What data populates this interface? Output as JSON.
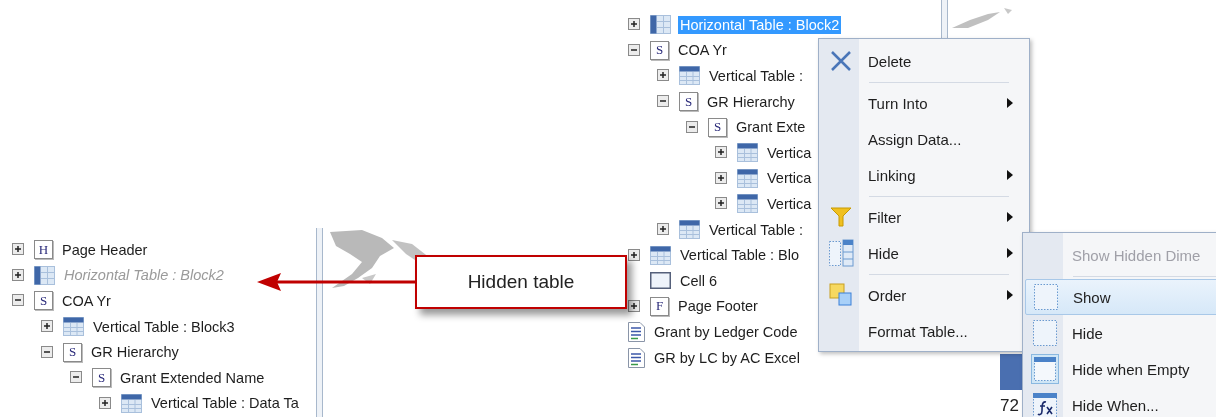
{
  "left_tree": [
    {
      "expanded": false,
      "kind": "letter",
      "glyph": "H",
      "label": "Page Header",
      "hidden": false
    },
    {
      "expanded": false,
      "kind": "htable",
      "label": "Horizontal Table : Block2",
      "hidden": true
    },
    {
      "expanded": true,
      "kind": "letter",
      "glyph": "S",
      "label": "COA Yr",
      "hidden": false,
      "children": [
        {
          "expanded": false,
          "kind": "vtable",
          "label": "Vertical Table : Block3",
          "hidden": false
        },
        {
          "expanded": true,
          "kind": "letter",
          "glyph": "S",
          "label": "GR Hierarchy",
          "hidden": false,
          "children": [
            {
              "expanded": true,
              "kind": "letter",
              "glyph": "S",
              "label": "Grant Extended Name",
              "hidden": false,
              "children": [
                {
                  "expanded": false,
                  "kind": "vtable",
                  "label": "Vertical Table : Data Ta",
                  "hidden": false
                }
              ]
            }
          ]
        }
      ]
    }
  ],
  "callout": {
    "text": "Hidden table"
  },
  "right_tree": [
    {
      "expanded": false,
      "kind": "htable",
      "label": "Horizontal Table : Block2",
      "selected": true
    },
    {
      "expanded": true,
      "kind": "letter",
      "glyph": "S",
      "label": "COA Yr",
      "selected": false,
      "children": [
        {
          "expanded": false,
          "kind": "vtable",
          "label": "Vertical Table :",
          "selected": false
        },
        {
          "expanded": true,
          "kind": "letter",
          "glyph": "S",
          "label": "GR Hierarchy",
          "selected": false,
          "children": [
            {
              "expanded": true,
              "kind": "letter",
              "glyph": "S",
              "label": "Grant Exte",
              "selected": false,
              "children": [
                {
                  "expanded": false,
                  "kind": "vtable",
                  "label": "Vertica",
                  "selected": false
                },
                {
                  "expanded": false,
                  "kind": "vtable",
                  "label": "Vertica",
                  "selected": false
                },
                {
                  "expanded": false,
                  "kind": "vtable",
                  "label": "Vertica",
                  "selected": false
                }
              ]
            }
          ]
        },
        {
          "expanded": false,
          "kind": "vtable",
          "label": "Vertical Table :",
          "selected": false
        }
      ]
    },
    {
      "expanded": false,
      "kind": "vtable",
      "label": "Vertical Table : Blo",
      "selected": false
    },
    {
      "kind": "cell",
      "label": "Cell 6",
      "selected": false
    },
    {
      "expanded": false,
      "kind": "letter",
      "glyph": "F",
      "label": "Page Footer",
      "selected": false
    },
    {
      "kind": "report",
      "label": "Grant by Ledger Code",
      "selected": false
    },
    {
      "kind": "report",
      "label": "GR by LC by AC Excel",
      "selected": false
    }
  ],
  "context_menu": [
    {
      "kind": "delete",
      "label": "Delete",
      "submenu": false
    },
    {
      "kind": "separator"
    },
    {
      "kind": "plain",
      "label": "Turn Into",
      "submenu": true
    },
    {
      "kind": "plain",
      "label": "Assign Data...",
      "submenu": false
    },
    {
      "kind": "plain",
      "label": "Linking",
      "submenu": true
    },
    {
      "kind": "separator"
    },
    {
      "kind": "filter",
      "label": "Filter",
      "submenu": true
    },
    {
      "kind": "hide",
      "label": "Hide",
      "submenu": true
    },
    {
      "kind": "separator"
    },
    {
      "kind": "order",
      "label": "Order",
      "submenu": true
    },
    {
      "kind": "plain",
      "label": "Format Table...",
      "submenu": false
    }
  ],
  "submenu": [
    {
      "kind": "plain",
      "label": "Show Hidden Dime",
      "disabled": true,
      "selected": false
    },
    {
      "kind": "separator"
    },
    {
      "kind": "dotted",
      "label": "Show",
      "disabled": false,
      "selected": true
    },
    {
      "kind": "dotted",
      "label": "Hide",
      "disabled": false,
      "selected": false
    },
    {
      "kind": "empty-table",
      "label": "Hide when Empty",
      "disabled": false,
      "selected": false
    },
    {
      "kind": "formula",
      "label": "Hide When...",
      "disabled": false,
      "selected": false
    }
  ],
  "background": {
    "cell_text": "72"
  }
}
